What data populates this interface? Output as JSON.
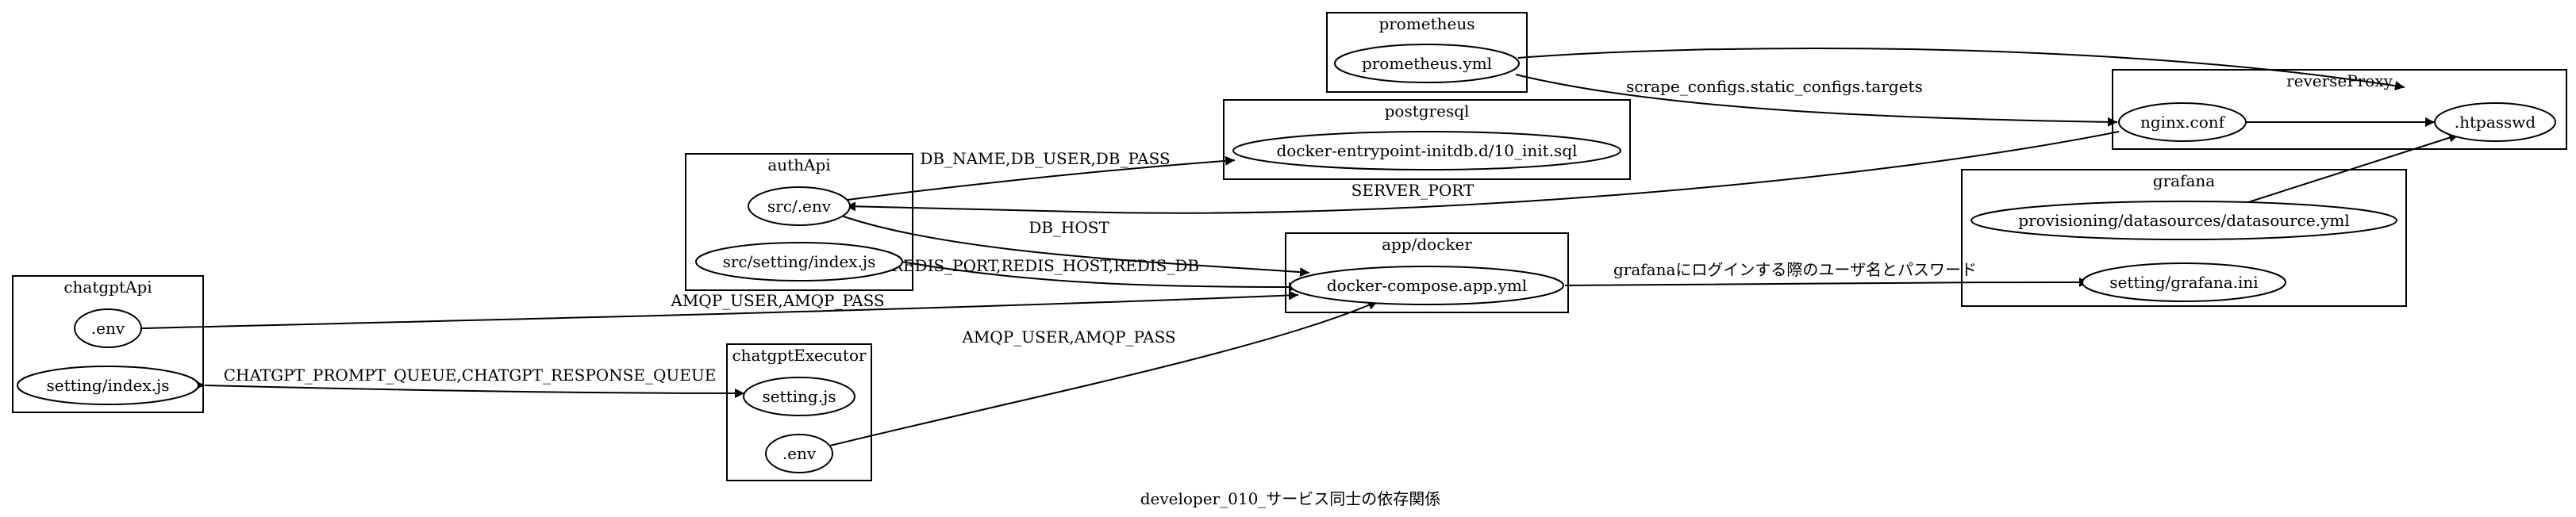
{
  "graph": {
    "title": "developer_010_サービス同士の依存関係"
  },
  "clusters": {
    "prometheus": "prometheus",
    "postgresql": "postgresql",
    "reverseProxy": "reverseProxy",
    "authApi": "authApi",
    "grafana": "grafana",
    "app_docker": "app/docker",
    "chatgptApi": "chatgptApi",
    "chatgptExecutor": "chatgptExecutor"
  },
  "nodes": {
    "prometheus_yml": "prometheus.yml",
    "init_sql": "docker-entrypoint-initdb.d/10_init.sql",
    "nginx_conf": "nginx.conf",
    "htpasswd": ".htpasswd",
    "auth_env": "src/.env",
    "auth_setting": "src/setting/index.js",
    "datasource_yml": "provisioning/datasources/datasource.yml",
    "grafana_ini": "setting/grafana.ini",
    "compose_yml": "docker-compose.app.yml",
    "chatgpt_env": ".env",
    "chatgpt_setting": "setting/index.js",
    "executor_setting": "setting.js",
    "executor_env": ".env"
  },
  "edges": {
    "scrape": "scrape_configs.static_configs.targets",
    "db_creds": "DB_NAME,DB_USER,DB_PASS",
    "server_port": "SERVER_PORT",
    "db_host": "DB_HOST",
    "redis": "REDIS_PORT,REDIS_HOST,REDIS_DB",
    "grafana_login": "grafanaにログインする際のユーザ名とパスワード",
    "amqp_api": "AMQP_USER,AMQP_PASS",
    "chatgpt_queue": "CHATGPT_PROMPT_QUEUE,CHATGPT_RESPONSE_QUEUE",
    "amqp_executor": "AMQP_USER,AMQP_PASS"
  }
}
